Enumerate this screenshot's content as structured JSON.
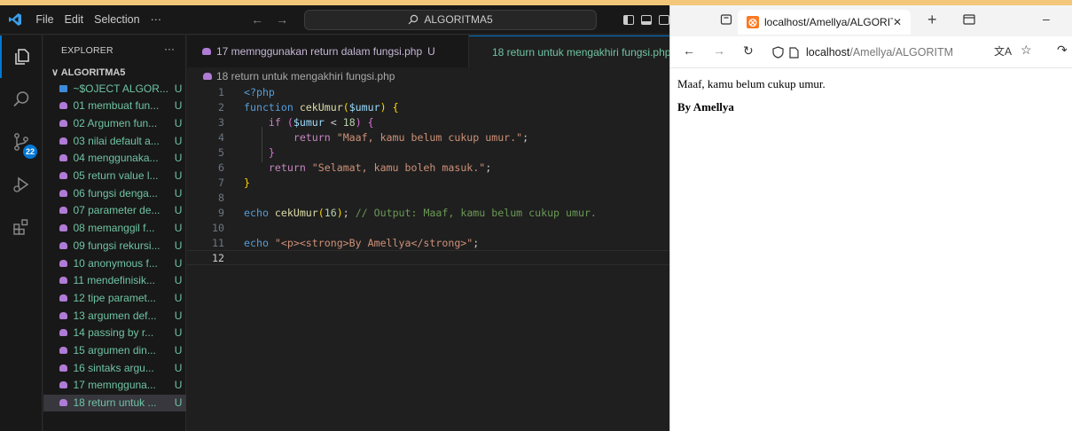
{
  "vscode": {
    "menu": [
      "File",
      "Edit",
      "Selection",
      "···"
    ],
    "command_center": "ALGORITMA5",
    "activity_badge": "22",
    "explorer_title": "EXPLORER",
    "explorer_more": "···",
    "folder_name": "∨ ALGORITMA5",
    "files": [
      {
        "name": "~$OJECT ALGOR...",
        "status": "U"
      },
      {
        "name": "01 membuat fun...",
        "status": "U"
      },
      {
        "name": "02 Argumen fun...",
        "status": "U"
      },
      {
        "name": "03 nilai default a...",
        "status": "U"
      },
      {
        "name": "04 menggunaka...",
        "status": "U"
      },
      {
        "name": "05 return value l...",
        "status": "U"
      },
      {
        "name": "06 fungsi denga...",
        "status": "U"
      },
      {
        "name": "07 parameter de...",
        "status": "U"
      },
      {
        "name": "08 memanggil f...",
        "status": "U"
      },
      {
        "name": "09 fungsi rekursi...",
        "status": "U"
      },
      {
        "name": "10 anonymous f...",
        "status": "U"
      },
      {
        "name": "11 mendefinisik...",
        "status": "U"
      },
      {
        "name": "12 tipe paramet...",
        "status": "U"
      },
      {
        "name": "13 argumen def...",
        "status": "U"
      },
      {
        "name": "14 passing  by r...",
        "status": "U"
      },
      {
        "name": "15 argumen din...",
        "status": "U"
      },
      {
        "name": "16 sintaks argu...",
        "status": "U"
      },
      {
        "name": "17 memngguna...",
        "status": "U"
      },
      {
        "name": "18 return untuk ...",
        "status": "U"
      }
    ],
    "tabs": [
      {
        "label": "17 memnggunakan return dalam fungsi.php",
        "status": "U"
      },
      {
        "label": "18 return untuk mengakhiri fungsi.php",
        "status": ""
      }
    ],
    "breadcrumb": "18 return untuk mengakhiri fungsi.php",
    "line_numbers": [
      "1",
      "2",
      "3",
      "4",
      "5",
      "6",
      "7",
      "8",
      "9",
      "10",
      "11",
      "12"
    ],
    "code": {
      "l1": "<?php",
      "l2_kw": "function",
      "l2_fn": "cekUmur",
      "l2_var": "$umur",
      "l3_kw": "if",
      "l3_var": "$umur",
      "l3_op": " < ",
      "l3_num": "18",
      "l4_kw": "return",
      "l4_str": "\"Maaf, kamu belum cukup umur.\"",
      "l6_kw": "return",
      "l6_str": "\"Selamat, kamu boleh masuk.\"",
      "l9_kw": "echo",
      "l9_fn": "cekUmur",
      "l9_num": "16",
      "l9_cmt": "// Output: Maaf, kamu belum cukup umur.",
      "l11_kw": "echo",
      "l11_str": "\"<p><strong>By Amellya</strong>\""
    }
  },
  "browser": {
    "tab_title": "localhost/Amellya/ALGORITMA",
    "tab_close": "✕",
    "new_tab": "+",
    "url_host": "localhost",
    "url_rest": "/Amellya/ALGORITM",
    "page_line1": "Maaf, kamu belum cukup umur.",
    "page_line2": "By Amellya"
  }
}
